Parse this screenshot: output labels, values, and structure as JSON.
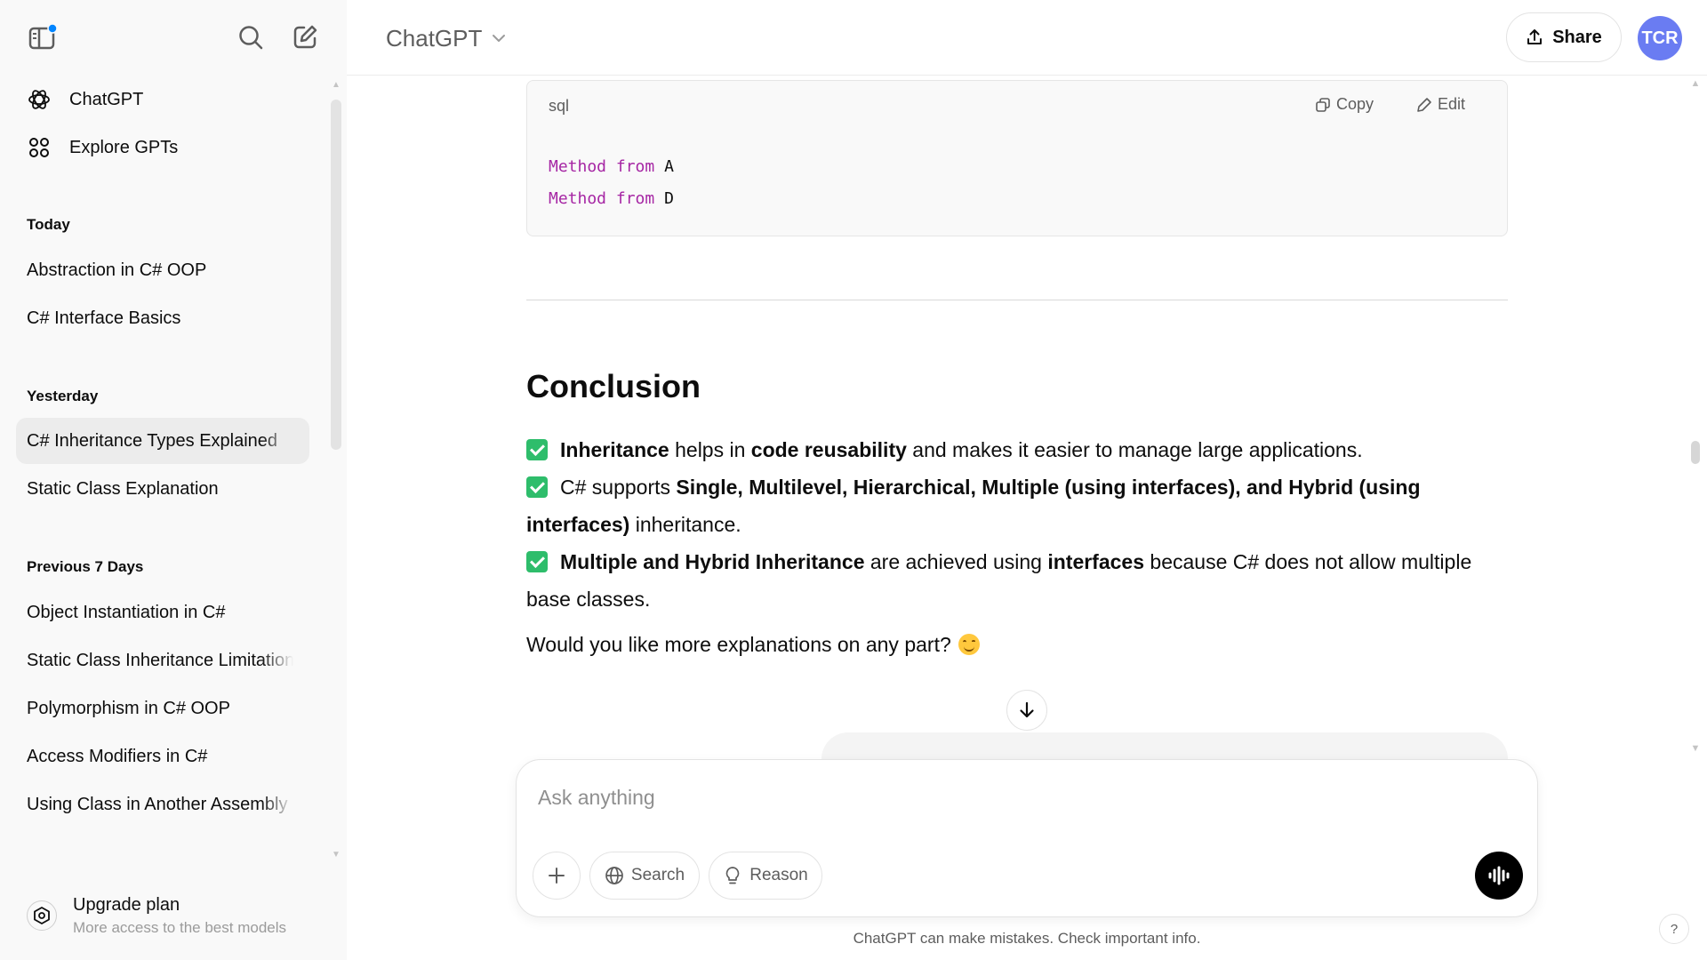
{
  "sidebar": {
    "nav": [
      {
        "label": "ChatGPT",
        "icon": "chatgpt-logo-icon"
      },
      {
        "label": "Explore GPTs",
        "icon": "grid-icon"
      }
    ],
    "groups": [
      {
        "label": "Today",
        "items": [
          "Abstraction in C# OOP",
          "C# Interface Basics"
        ]
      },
      {
        "label": "Yesterday",
        "items": [
          "C# Inheritance Types Explained",
          "Static Class Explanation"
        ]
      },
      {
        "label": "Previous 7 Days",
        "items": [
          "Object Instantiation in C#",
          "Static Class Inheritance Limitations",
          "Polymorphism in C# OOP",
          "Access Modifiers in C#",
          "Using Class in Another Assembly"
        ]
      }
    ],
    "active_item": "C# Inheritance Types Explained",
    "upgrade": {
      "title": "Upgrade plan",
      "subtitle": "More access to the best models"
    }
  },
  "header": {
    "model": "ChatGPT",
    "share_label": "Share",
    "avatar_initials": "TCR",
    "avatar_color": "#6a7cf2"
  },
  "code_block": {
    "language": "sql",
    "copy_label": "Copy",
    "edit_label": "Edit",
    "lines": [
      {
        "k1": "Method",
        "k2": "from",
        "rest": " A"
      },
      {
        "k1": "Method",
        "k2": "from",
        "rest": " D"
      }
    ]
  },
  "conclusion": {
    "title": "Conclusion",
    "p1": {
      "b1": "Inheritance",
      "t1": " helps in ",
      "b2": "code reusability",
      "t2": " and makes it easier to manage large applications."
    },
    "p2": {
      "t1": "C# supports ",
      "b1": "Single, Multilevel, Hierarchical, Multiple (using interfaces), and Hybrid (using interfaces)",
      "t2": " inheritance."
    },
    "p3": {
      "b1": "Multiple and Hybrid Inheritance",
      "t1": " are achieved using ",
      "b2": "interfaces",
      "t2": " because C# does not allow multiple base classes."
    },
    "question": "Would you like more explanations on any part?"
  },
  "composer": {
    "placeholder": "Ask anything",
    "search_label": "Search",
    "reason_label": "Reason"
  },
  "footer": {
    "disclaimer": "ChatGPT can make mistakes. Check important info.",
    "help": "?"
  },
  "colors": {
    "sidebar_bg": "#f9f9f9",
    "active_item_bg": "#ececec",
    "keyword": "#a626a4",
    "check_green": "#2ebd6b",
    "notification_dot": "#0285ff"
  }
}
